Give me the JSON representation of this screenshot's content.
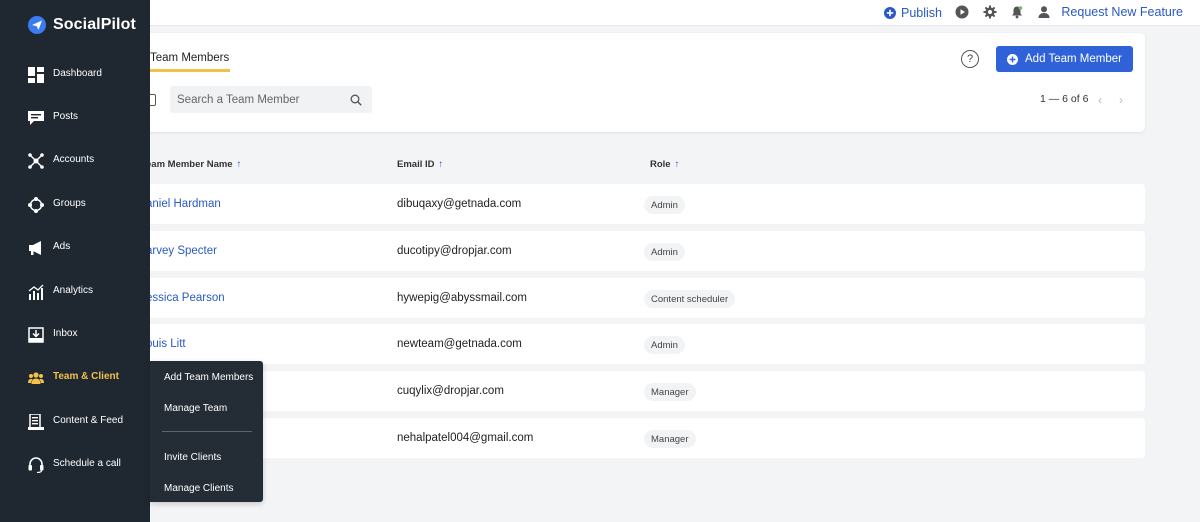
{
  "brand": {
    "name": "SocialPilot",
    "logo_icon": "paper-plane-icon"
  },
  "topbar": {
    "publish_label": "Publish",
    "request_feature_label": "Request New Feature",
    "icons": [
      "play-icon",
      "gear-icon",
      "bell-icon",
      "user-icon"
    ]
  },
  "sidebar": {
    "items": [
      {
        "label": "Dashboard",
        "icon": "dashboard-icon"
      },
      {
        "label": "Posts",
        "icon": "posts-icon"
      },
      {
        "label": "Accounts",
        "icon": "accounts-icon"
      },
      {
        "label": "Groups",
        "icon": "groups-icon"
      },
      {
        "label": "Ads",
        "icon": "megaphone-icon"
      },
      {
        "label": "Analytics",
        "icon": "analytics-icon"
      },
      {
        "label": "Inbox",
        "icon": "inbox-icon"
      },
      {
        "label": "Team & Client",
        "icon": "team-icon",
        "active": true
      },
      {
        "label": "Content & Feed",
        "icon": "content-feed-icon"
      },
      {
        "label": "Schedule a call",
        "icon": "headset-icon"
      }
    ]
  },
  "submenu": {
    "items": [
      "Add Team Members",
      "Manage Team",
      "Invite Clients",
      "Manage Clients"
    ]
  },
  "main": {
    "tab_label": "Team Members",
    "search_placeholder": "Search a Team Member",
    "help_label": "?",
    "add_button_label": "Add Team Member",
    "pagination": "1 — 6 of 6",
    "prev_arrow": "‹",
    "next_arrow": "›"
  },
  "table": {
    "headers": [
      {
        "label": "eam Member Name",
        "arrow": "↑"
      },
      {
        "label": "Email ID",
        "arrow": "↑"
      },
      {
        "label": "Role",
        "arrow": "↑"
      }
    ],
    "rows": [
      {
        "name": "aniel Hardman",
        "email": "dibuqaxy@getnada.com",
        "role": "Admin"
      },
      {
        "name": "arvey Specter",
        "email": "ducotipy@dropjar.com",
        "role": "Admin"
      },
      {
        "name": "essica Pearson",
        "email": "hywepig@abyssmail.com",
        "role": "Content scheduler"
      },
      {
        "name": "ouis Litt",
        "email": "newteam@getnada.com",
        "role": "Admin"
      },
      {
        "name": "",
        "email": "cuqylix@dropjar.com",
        "role": "Manager"
      },
      {
        "name": "",
        "email": "nehalpatel004@gmail.com",
        "role": "Manager"
      }
    ]
  },
  "colors": {
    "sidebar_bg": "#1f2731",
    "accent_blue": "#2f62d8",
    "link_blue": "#2b59c3",
    "active_yellow": "#f2c14b"
  }
}
